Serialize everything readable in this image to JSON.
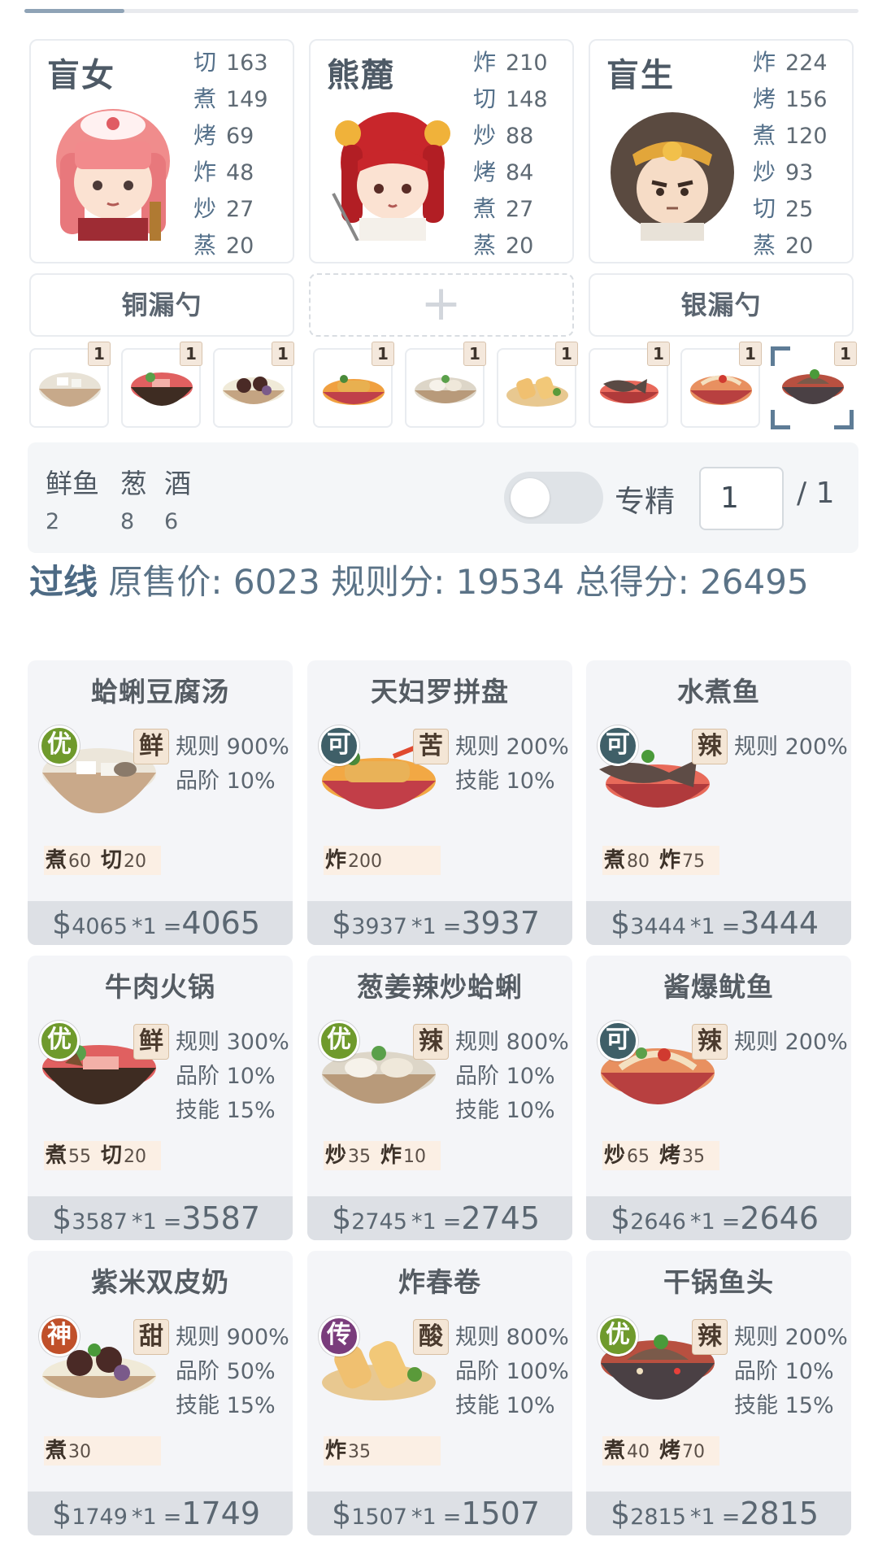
{
  "progress": {
    "fraction": 0.12
  },
  "chefs": [
    {
      "name": "盲女",
      "skills": [
        {
          "k": "切",
          "v": "163"
        },
        {
          "k": "煮",
          "v": "149"
        },
        {
          "k": "烤",
          "v": "69"
        },
        {
          "k": "炸",
          "v": "48"
        },
        {
          "k": "炒",
          "v": "27"
        },
        {
          "k": "蒸",
          "v": "20"
        }
      ]
    },
    {
      "name": "熊麓",
      "skills": [
        {
          "k": "炸",
          "v": "210"
        },
        {
          "k": "切",
          "v": "148"
        },
        {
          "k": "炒",
          "v": "88"
        },
        {
          "k": "烤",
          "v": "84"
        },
        {
          "k": "煮",
          "v": "27"
        },
        {
          "k": "蒸",
          "v": "20"
        }
      ]
    },
    {
      "name": "盲生",
      "skills": [
        {
          "k": "炸",
          "v": "224"
        },
        {
          "k": "烤",
          "v": "156"
        },
        {
          "k": "煮",
          "v": "120"
        },
        {
          "k": "炒",
          "v": "93"
        },
        {
          "k": "切",
          "v": "25"
        },
        {
          "k": "蒸",
          "v": "20"
        }
      ]
    }
  ],
  "tools": [
    "铜漏勺",
    "+",
    "银漏勺"
  ],
  "thumb_badges": [
    "1",
    "1",
    "1",
    "1",
    "1",
    "1",
    "1",
    "1",
    "1"
  ],
  "ingredients": [
    {
      "name": "鲜鱼",
      "count": "2"
    },
    {
      "name": "葱",
      "count": "8"
    },
    {
      "name": "酒",
      "count": "6"
    }
  ],
  "specialize": {
    "label": "专精",
    "page_value": "1",
    "page_total": "/ 1",
    "enabled": false
  },
  "summary": {
    "pass": "过线",
    "text": "原售价:  6023 规则分:  19534 总得分:  26495"
  },
  "dishes": [
    {
      "name": "蛤蜊豆腐汤",
      "grade": "优",
      "grade_color": "#6f9a2c",
      "flavor": "鲜",
      "effects": [
        "规则 900%",
        "品阶 10%"
      ],
      "mats": [
        {
          "k": "煮",
          "v": "60"
        },
        {
          "k": "切",
          "v": "20"
        }
      ],
      "price": "4065",
      "mult": "*1",
      "total": "4065"
    },
    {
      "name": "天妇罗拼盘",
      "grade": "可",
      "grade_color": "#3f5f68",
      "flavor": "苦",
      "effects": [
        "规则 200%",
        "技能 10%"
      ],
      "mats": [
        {
          "k": "炸",
          "v": "200"
        }
      ],
      "price": "3937",
      "mult": "*1",
      "total": "3937"
    },
    {
      "name": "水煮鱼",
      "grade": "可",
      "grade_color": "#3f5f68",
      "flavor": "辣",
      "effects": [
        "规则 200%"
      ],
      "mats": [
        {
          "k": "煮",
          "v": "80"
        },
        {
          "k": "炸",
          "v": "75"
        }
      ],
      "price": "3444",
      "mult": "*1",
      "total": "3444"
    },
    {
      "name": "牛肉火锅",
      "grade": "优",
      "grade_color": "#6f9a2c",
      "flavor": "鲜",
      "effects": [
        "规则 300%",
        "品阶 10%",
        "技能 15%"
      ],
      "mats": [
        {
          "k": "煮",
          "v": "55"
        },
        {
          "k": "切",
          "v": "20"
        }
      ],
      "price": "3587",
      "mult": "*1",
      "total": "3587"
    },
    {
      "name": "葱姜辣炒蛤蜊",
      "grade": "优",
      "grade_color": "#6f9a2c",
      "flavor": "辣",
      "effects": [
        "规则 800%",
        "品阶 10%",
        "技能 10%"
      ],
      "mats": [
        {
          "k": "炒",
          "v": "35"
        },
        {
          "k": "炸",
          "v": "10"
        }
      ],
      "price": "2745",
      "mult": "*1",
      "total": "2745"
    },
    {
      "name": "酱爆鱿鱼",
      "grade": "可",
      "grade_color": "#3f5f68",
      "flavor": "辣",
      "effects": [
        "规则 200%"
      ],
      "mats": [
        {
          "k": "炒",
          "v": "65"
        },
        {
          "k": "烤",
          "v": "35"
        }
      ],
      "price": "2646",
      "mult": "*1",
      "total": "2646"
    },
    {
      "name": "紫米双皮奶",
      "grade": "神",
      "grade_color": "#c0502a",
      "flavor": "甜",
      "effects": [
        "规则 900%",
        "品阶 50%",
        "技能 15%"
      ],
      "mats": [
        {
          "k": "煮",
          "v": "30"
        }
      ],
      "price": "1749",
      "mult": "*1",
      "total": "1749"
    },
    {
      "name": "炸春卷",
      "grade": "传",
      "grade_color": "#7a3d7c",
      "flavor": "酸",
      "effects": [
        "规则 800%",
        "品阶 100%",
        "技能 10%"
      ],
      "mats": [
        {
          "k": "炸",
          "v": "35"
        }
      ],
      "price": "1507",
      "mult": "*1",
      "total": "1507"
    },
    {
      "name": "干锅鱼头",
      "grade": "优",
      "grade_color": "#6f9a2c",
      "flavor": "辣",
      "effects": [
        "规则 200%",
        "品阶 10%",
        "技能 15%"
      ],
      "mats": [
        {
          "k": "煮",
          "v": "40"
        },
        {
          "k": "烤",
          "v": "70"
        }
      ],
      "price": "2815",
      "mult": "*1",
      "total": "2815"
    }
  ]
}
